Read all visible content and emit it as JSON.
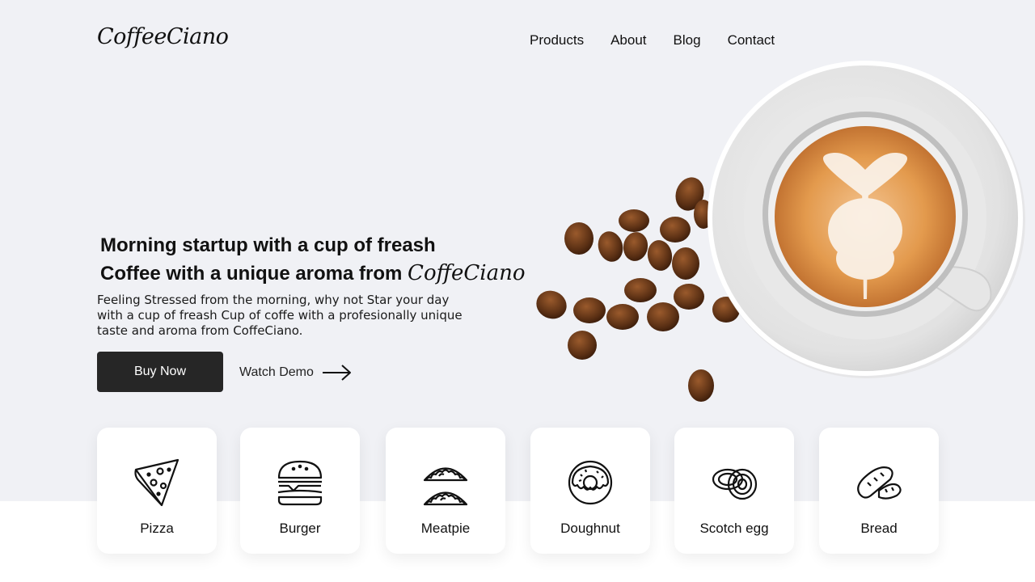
{
  "header": {
    "logo": "CoffeeCiano",
    "nav": [
      "Products",
      "About",
      "Blog",
      "Contact"
    ]
  },
  "hero": {
    "headline_line1": "Morning startup with a cup of freash",
    "headline_line2_prefix": "Coffee with a unique aroma from",
    "headline_brand": "CoffeCiano",
    "description": "Feeling Stressed from the morning, why not Star your day with a cup of freash Cup of coffe with a profesionally unique taste and aroma from CoffeCiano.",
    "buy_label": "Buy Now",
    "watch_label": "Watch Demo",
    "watch_icon": "arrow-right-icon",
    "image": "latte-cup-with-coffee-beans"
  },
  "categories": [
    {
      "label": "Pizza",
      "icon": "pizza-icon"
    },
    {
      "label": "Burger",
      "icon": "burger-icon"
    },
    {
      "label": "Meatpie",
      "icon": "meatpie-icon"
    },
    {
      "label": "Doughnut",
      "icon": "doughnut-icon"
    },
    {
      "label": "Scotch egg",
      "icon": "scotch-egg-icon"
    },
    {
      "label": "Bread",
      "icon": "bread-icon"
    }
  ],
  "colors": {
    "background": "#f0f1f5",
    "button": "#262626",
    "card": "#ffffff",
    "coffee": "#d9883f"
  }
}
